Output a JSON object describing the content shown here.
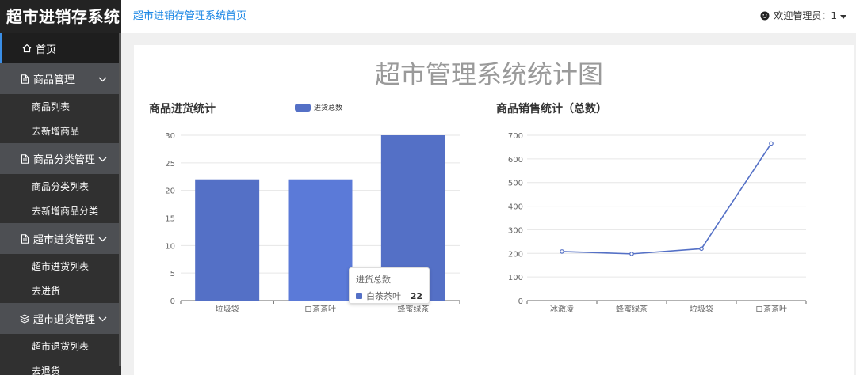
{
  "app": {
    "title": "超市进销存系统"
  },
  "header": {
    "home_link": "超市进销存管理系统首页",
    "user_label": "欢迎管理员：1"
  },
  "sidebar": {
    "home": "首页",
    "groups": [
      {
        "label": "商品管理",
        "icon": "file-icon",
        "items": [
          "商品列表",
          "去新增商品"
        ]
      },
      {
        "label": "商品分类管理",
        "icon": "file-icon",
        "items": [
          "商品分类列表",
          "去新增商品分类"
        ]
      },
      {
        "label": "超市进货管理",
        "icon": "file-icon",
        "items": [
          "超市进货列表",
          "去进货"
        ]
      },
      {
        "label": "超市退货管理",
        "icon": "layers-icon",
        "items": [
          "超市退货列表",
          "去退货"
        ]
      }
    ]
  },
  "main": {
    "title": "超市管理系统统计图"
  },
  "colors": {
    "accent": "#1e88e5",
    "bar": "#5470c6",
    "bar_highlight": "#5b7ad8"
  },
  "chart_data": [
    {
      "type": "bar",
      "title": "商品进货统计",
      "series": [
        {
          "name": "进货总数",
          "values": [
            22,
            22,
            30
          ]
        }
      ],
      "categories": [
        "垃圾袋",
        "白茶茶叶",
        "蜂蜜绿茶"
      ],
      "ylim": [
        0,
        30
      ],
      "yticks": [
        0,
        5,
        10,
        15,
        20,
        25,
        30
      ],
      "grid": true,
      "legend": "top",
      "tooltip": {
        "title": "进货总数",
        "label": "白茶茶叶",
        "value": "22"
      }
    },
    {
      "type": "line",
      "title": "商品销售统计（总数）",
      "categories": [
        "冰激凌",
        "蜂蜜绿茶",
        "垃圾袋",
        "白茶茶叶"
      ],
      "values": [
        208,
        198,
        220,
        665
      ],
      "ylim": [
        0,
        700
      ],
      "yticks": [
        0,
        100,
        200,
        300,
        400,
        500,
        600,
        700
      ],
      "grid": true
    }
  ]
}
